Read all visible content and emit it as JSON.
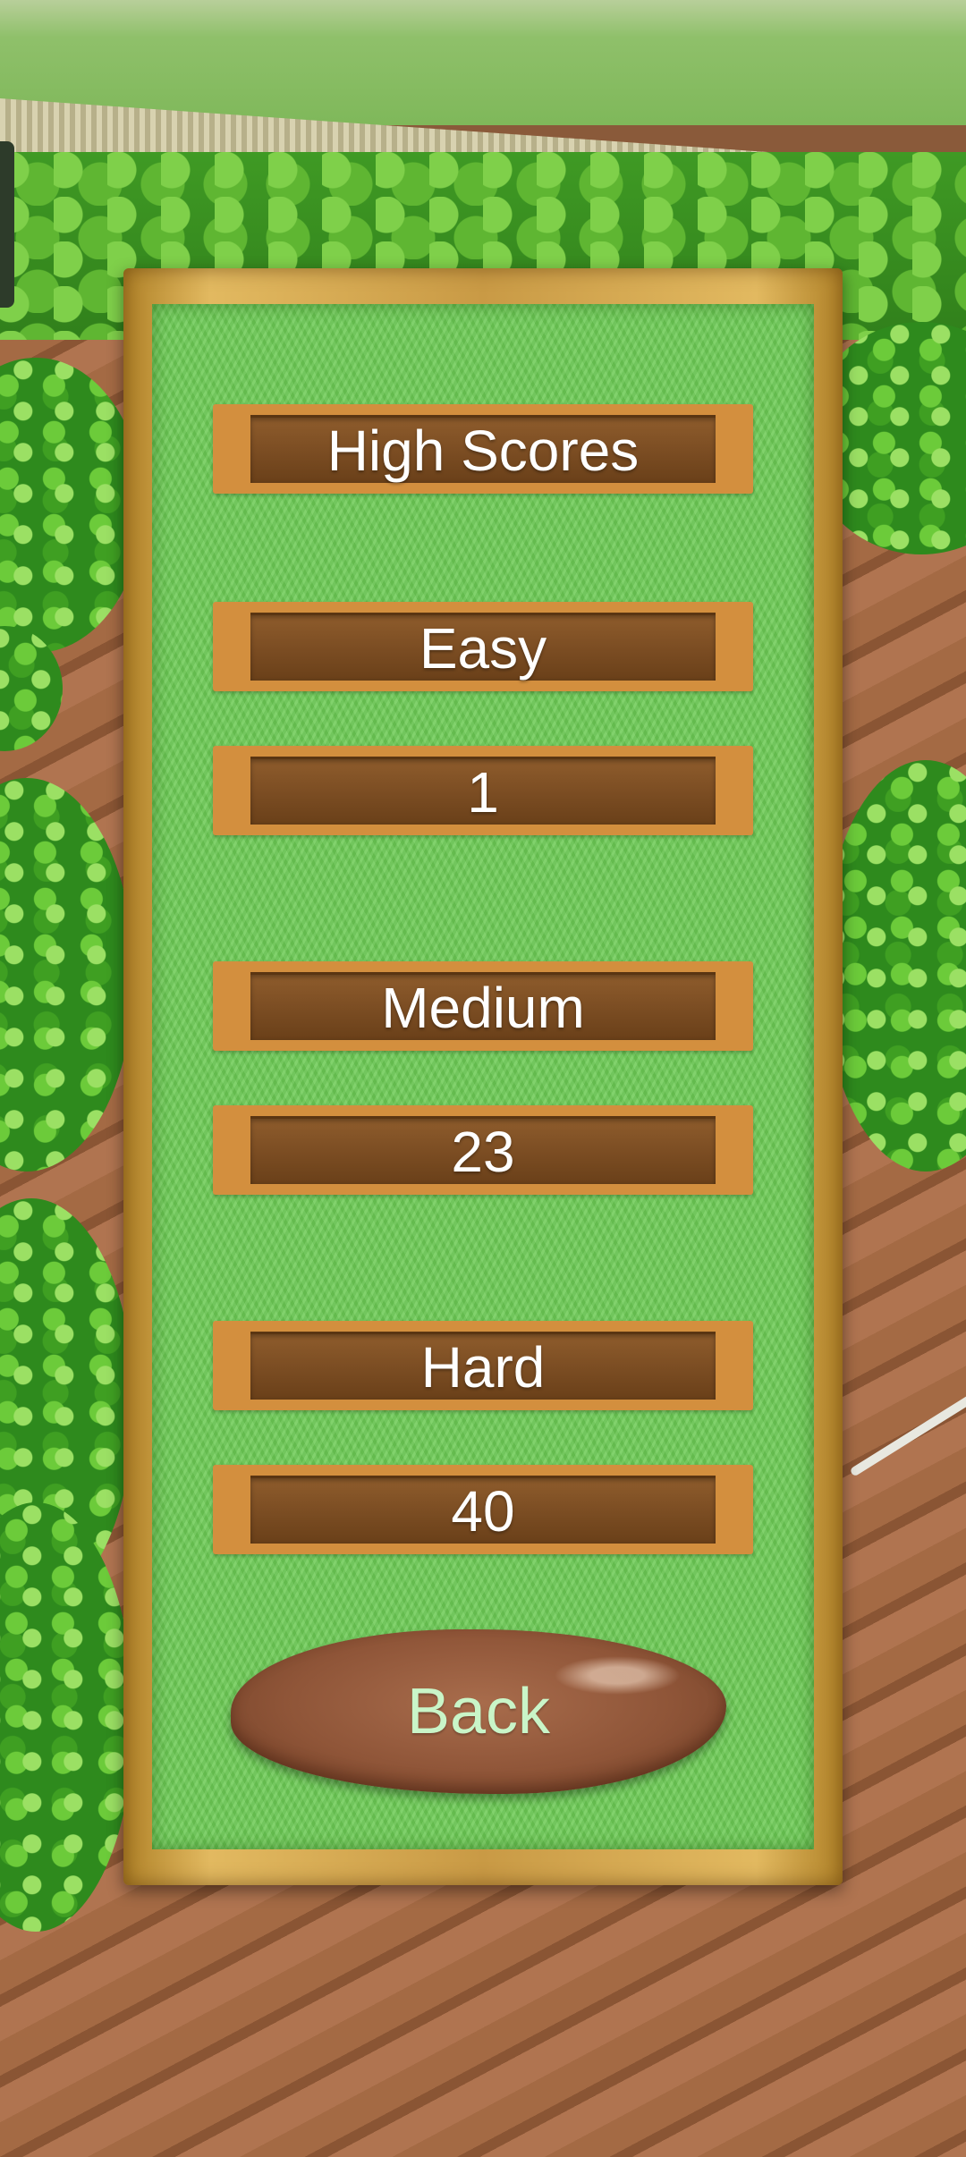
{
  "screen": {
    "title": "High Scores",
    "difficulties": [
      {
        "label": "Easy",
        "score": "1"
      },
      {
        "label": "Medium",
        "score": "23"
      },
      {
        "label": "Hard",
        "score": "40"
      }
    ],
    "back_label": "Back"
  },
  "colors": {
    "panel_frame": "#c99a45",
    "panel_grass": "#6fcb58",
    "bar_outer": "#d38f3e",
    "bar_inner": "#7a4c22",
    "bar_text": "#ffffff",
    "back_button": "#8f5538",
    "back_text": "#c9f5c8"
  }
}
